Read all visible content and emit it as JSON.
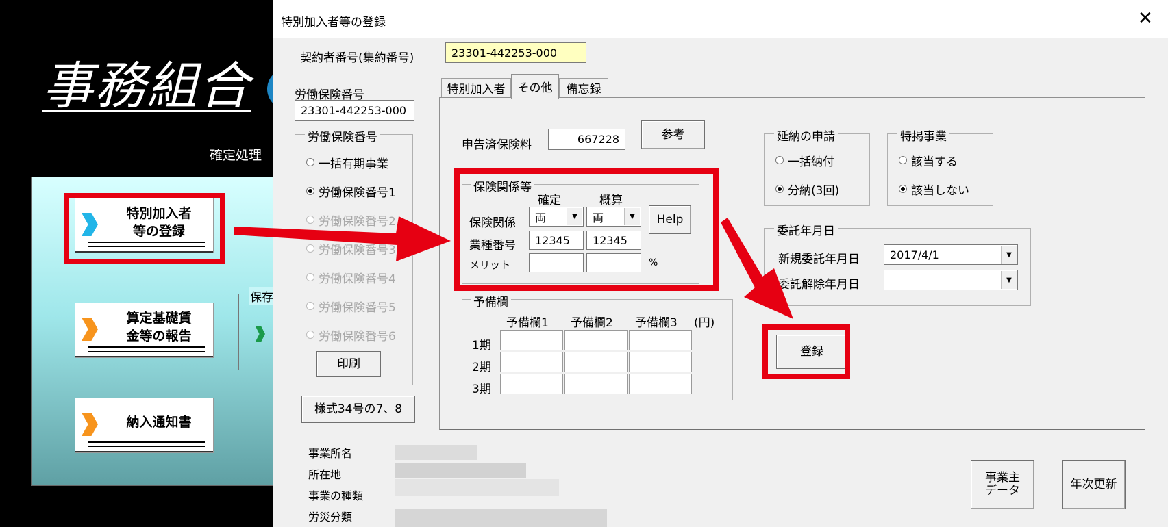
{
  "background_app": {
    "title": "事務組合",
    "caption": "確定処理",
    "menu": [
      {
        "label": "特別加入者\n等の登録",
        "chevron_color": "#22b5e8"
      },
      {
        "label": "算定基礎賃\n金等の報告",
        "chevron_color": "#f7941d"
      },
      {
        "label": "納入通知書",
        "chevron_color": "#f7941d"
      }
    ],
    "partial_group_label": "保存"
  },
  "dialog": {
    "title": "特別加入者等の登録",
    "close_glyph": "✕",
    "contract_label": "契約者番号(集約番号)",
    "contract_value": "23301-442253-000",
    "labor_no_label": "労働保険番号",
    "labor_no_value": "23301-442253-000",
    "labor_group": {
      "title": "労働保険番号",
      "options": [
        {
          "label": "一括有期事業",
          "selected": false,
          "enabled": true
        },
        {
          "label": "労働保険番号1",
          "selected": true,
          "enabled": true
        },
        {
          "label": "労働保険番号2",
          "selected": false,
          "enabled": false
        },
        {
          "label": "労働保険番号3",
          "selected": false,
          "enabled": false
        },
        {
          "label": "労働保険番号4",
          "selected": false,
          "enabled": false
        },
        {
          "label": "労働保険番号5",
          "selected": false,
          "enabled": false
        },
        {
          "label": "労働保険番号6",
          "selected": false,
          "enabled": false
        }
      ],
      "print_button": "印刷"
    },
    "form34_button": "様式34号の7、8",
    "tabs": [
      {
        "label": "特別加入者",
        "active": false
      },
      {
        "label": "その他",
        "active": true
      },
      {
        "label": "備忘録",
        "active": false
      }
    ],
    "declared_premium_label": "申告済保険料",
    "declared_premium_value": "667228",
    "reference_button": "参考",
    "insurance_group": {
      "title": "保険関係等",
      "col_confirmed": "確定",
      "col_estimate": "概算",
      "row_relation": "保険関係",
      "relation_confirmed": "両",
      "relation_estimate": "両",
      "row_industry": "業種番号",
      "industry_confirmed": "12345",
      "industry_estimate": "12345",
      "row_merit": "メリット",
      "merit_unit": "%",
      "help_button": "Help"
    },
    "reserve_group": {
      "title": "予備欄",
      "columns": [
        "予備欄1",
        "予備欄2",
        "予備欄3",
        "(円)"
      ],
      "rows": [
        "1期",
        "2期",
        "3期"
      ]
    },
    "deferred_group": {
      "title": "延納の申請",
      "options": [
        {
          "label": "一括納付",
          "selected": false
        },
        {
          "label": "分納(3回)",
          "selected": true
        }
      ]
    },
    "special_group": {
      "title": "特掲事業",
      "options": [
        {
          "label": "該当する",
          "selected": false
        },
        {
          "label": "該当しない",
          "selected": true
        }
      ]
    },
    "commission_group": {
      "title": "委託年月日",
      "new_label": "新規委託年月日",
      "new_value": "2017/4/1",
      "cancel_label": "委託解除年月日",
      "cancel_value": ""
    },
    "register_button": "登録",
    "info": {
      "office_name_label": "事業所名",
      "address_label": "所在地",
      "business_type_label": "事業の種類",
      "accident_class_label": "労災分類"
    },
    "employer_data_button": "事業主\nデータ",
    "annual_update_button": "年次更新"
  },
  "annotation_color": "#e60012"
}
